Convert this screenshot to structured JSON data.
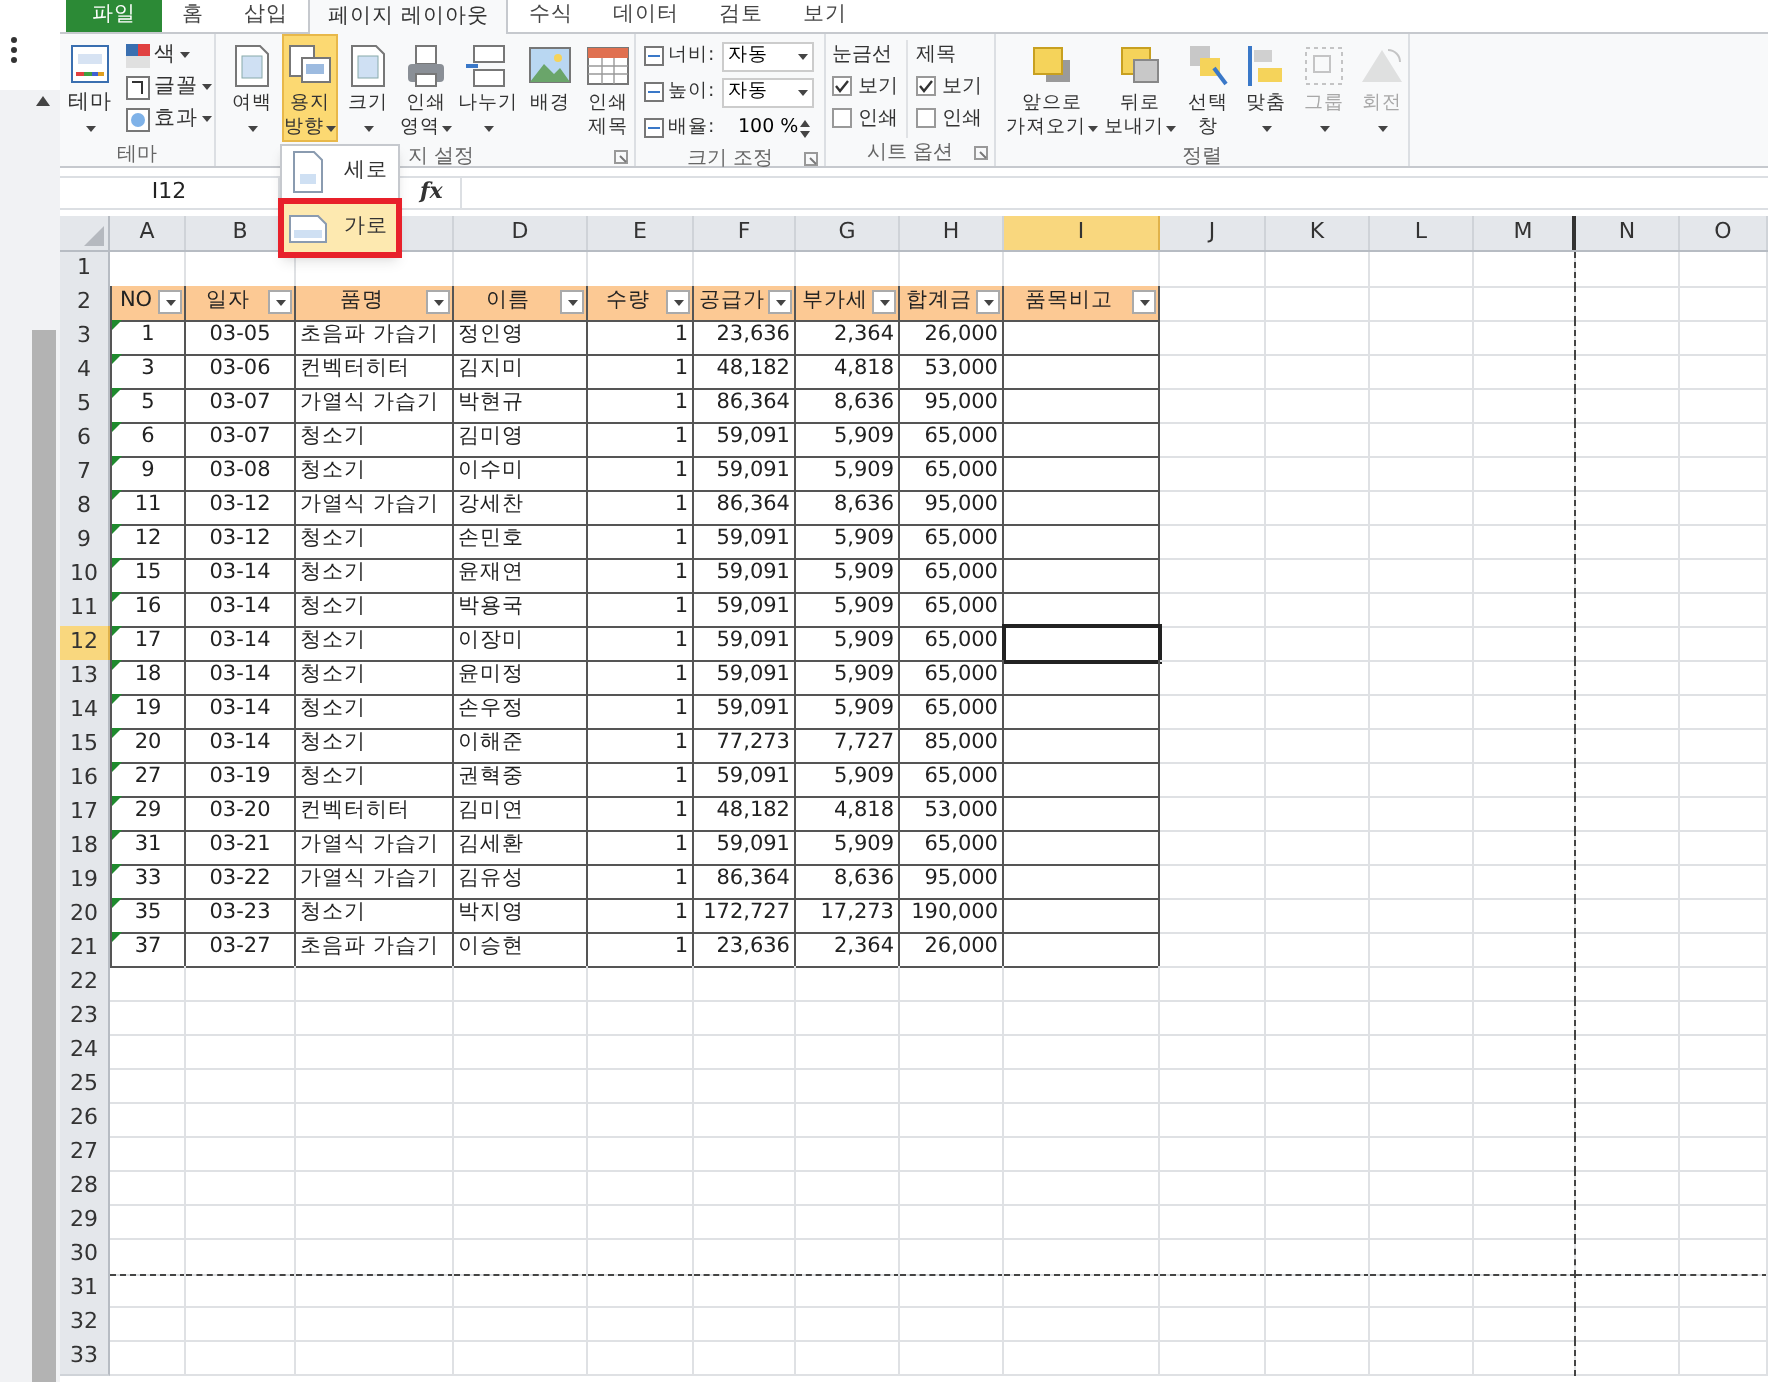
{
  "ribbon": {
    "tabs": [
      {
        "label": "파일",
        "kind": "file",
        "selected": false
      },
      {
        "label": "홈",
        "kind": "tab",
        "selected": false
      },
      {
        "label": "삽입",
        "kind": "tab",
        "selected": false
      },
      {
        "label": "페이지 레이아웃",
        "kind": "tab",
        "selected": true
      },
      {
        "label": "수식",
        "kind": "tab",
        "selected": false
      },
      {
        "label": "데이터",
        "kind": "tab",
        "selected": false
      },
      {
        "label": "검토",
        "kind": "tab",
        "selected": false
      },
      {
        "label": "보기",
        "kind": "tab",
        "selected": false
      }
    ],
    "theme_group": {
      "label": "테마",
      "big_button": {
        "label": "테마"
      },
      "items": [
        {
          "label": "색"
        },
        {
          "label": "글꼴"
        },
        {
          "label": "효과"
        }
      ]
    },
    "page_setup_group": {
      "label": "지 설정",
      "buttons": [
        {
          "lines": [
            "여백"
          ],
          "dropdown": true,
          "active": false
        },
        {
          "lines": [
            "용지",
            "방향"
          ],
          "dropdown": true,
          "active": true
        },
        {
          "lines": [
            "크기"
          ],
          "dropdown": true,
          "active": false
        },
        {
          "lines": [
            "인쇄",
            "영역"
          ],
          "dropdown": true,
          "active": false
        },
        {
          "lines": [
            "나누기"
          ],
          "dropdown": true,
          "active": false
        },
        {
          "lines": [
            "배경"
          ],
          "dropdown": false,
          "active": false
        },
        {
          "lines": [
            "인쇄",
            "제목"
          ],
          "dropdown": false,
          "active": false
        }
      ]
    },
    "scale_group": {
      "label": "크기 조정",
      "fields": [
        {
          "label": "너비:",
          "value": "자동",
          "kind": "dropdown"
        },
        {
          "label": "높이:",
          "value": "자동",
          "kind": "dropdown"
        },
        {
          "label": "배율:",
          "value": "100 %",
          "kind": "spinner"
        }
      ]
    },
    "sheet_options_group": {
      "label": "시트 옵션",
      "columns": [
        {
          "title": "눈금선",
          "options": [
            {
              "label": "보기",
              "checked": true
            },
            {
              "label": "인쇄",
              "checked": false
            }
          ]
        },
        {
          "title": "제목",
          "options": [
            {
              "label": "보기",
              "checked": true
            },
            {
              "label": "인쇄",
              "checked": false
            }
          ]
        }
      ]
    },
    "arrange_group": {
      "label": "정렬",
      "buttons": [
        {
          "lines": [
            "앞으로",
            "가져오기"
          ],
          "dropdown": true,
          "disabled": false
        },
        {
          "lines": [
            "뒤로",
            "보내기"
          ],
          "dropdown": true,
          "disabled": false
        },
        {
          "lines": [
            "선택",
            "창"
          ],
          "dropdown": false,
          "disabled": false
        },
        {
          "lines": [
            "맞춤"
          ],
          "dropdown": true,
          "disabled": false
        },
        {
          "lines": [
            "그룹"
          ],
          "dropdown": true,
          "disabled": true
        },
        {
          "lines": [
            "회전"
          ],
          "dropdown": true,
          "disabled": true
        }
      ]
    }
  },
  "orientation_menu": {
    "items": [
      {
        "label": "세로",
        "selected": false
      },
      {
        "label": "가로",
        "selected": true
      }
    ]
  },
  "formula_bar": {
    "name_box": "I12",
    "fx": "fx"
  },
  "sheet": {
    "columns": [
      {
        "label": "A",
        "selected": false,
        "page_break": false
      },
      {
        "label": "B",
        "selected": false,
        "page_break": false
      },
      {
        "selected": false,
        "page_break": false
      },
      {
        "label": "D",
        "selected": false,
        "page_break": false
      },
      {
        "label": "E",
        "selected": false,
        "page_break": false
      },
      {
        "label": "F",
        "selected": false,
        "page_break": false
      },
      {
        "label": "G",
        "selected": false,
        "page_break": false
      },
      {
        "label": "H",
        "selected": false,
        "page_break": false
      },
      {
        "label": "I",
        "selected": true,
        "page_break": false
      },
      {
        "label": "J",
        "selected": false,
        "page_break": false
      },
      {
        "label": "K",
        "selected": false,
        "page_break": false
      },
      {
        "label": "L",
        "selected": false,
        "page_break": false
      },
      {
        "label": "M",
        "selected": false,
        "page_break": true
      },
      {
        "label": "N",
        "selected": false,
        "page_break": false
      },
      {
        "label": "O",
        "selected": false,
        "page_break": false
      }
    ],
    "rows": [
      {
        "header": "1",
        "kind": "empty",
        "selected": false,
        "page_break": false
      },
      {
        "header": "2",
        "kind": "table_header",
        "selected": false,
        "page_break": false,
        "cells": [
          "NO",
          "일자",
          "품명",
          "이름",
          "수량",
          "공급가",
          "부가세",
          "합계금",
          "품목비고"
        ]
      },
      {
        "header": "3",
        "kind": "data",
        "selected": false,
        "page_break": false,
        "error_mark": true,
        "cells": [
          "1",
          "03-05",
          "초음파 가습기",
          "정인영",
          "1",
          "23,636",
          "2,364",
          "26,000"
        ]
      },
      {
        "header": "4",
        "kind": "data",
        "selected": false,
        "page_break": false,
        "error_mark": true,
        "cells": [
          "3",
          "03-06",
          "컨벡터히터",
          "김지미",
          "1",
          "48,182",
          "4,818",
          "53,000"
        ]
      },
      {
        "header": "5",
        "kind": "data",
        "selected": false,
        "page_break": false,
        "error_mark": true,
        "cells": [
          "5",
          "03-07",
          "가열식 가습기",
          "박현규",
          "1",
          "86,364",
          "8,636",
          "95,000"
        ]
      },
      {
        "header": "6",
        "kind": "data",
        "selected": false,
        "page_break": false,
        "error_mark": true,
        "cells": [
          "6",
          "03-07",
          "청소기",
          "김미영",
          "1",
          "59,091",
          "5,909",
          "65,000"
        ]
      },
      {
        "header": "7",
        "kind": "data",
        "selected": false,
        "page_break": false,
        "error_mark": true,
        "cells": [
          "9",
          "03-08",
          "청소기",
          "이수미",
          "1",
          "59,091",
          "5,909",
          "65,000"
        ]
      },
      {
        "header": "8",
        "kind": "data",
        "selected": false,
        "page_break": false,
        "error_mark": true,
        "cells": [
          "11",
          "03-12",
          "가열식 가습기",
          "강세찬",
          "1",
          "86,364",
          "8,636",
          "95,000"
        ]
      },
      {
        "header": "9",
        "kind": "data",
        "selected": false,
        "page_break": false,
        "error_mark": true,
        "cells": [
          "12",
          "03-12",
          "청소기",
          "손민호",
          "1",
          "59,091",
          "5,909",
          "65,000"
        ]
      },
      {
        "header": "10",
        "kind": "data",
        "selected": false,
        "page_break": false,
        "error_mark": true,
        "cells": [
          "15",
          "03-14",
          "청소기",
          "윤재연",
          "1",
          "59,091",
          "5,909",
          "65,000"
        ]
      },
      {
        "header": "11",
        "kind": "data",
        "selected": false,
        "page_break": false,
        "error_mark": true,
        "cells": [
          "16",
          "03-14",
          "청소기",
          "박용국",
          "1",
          "59,091",
          "5,909",
          "65,000"
        ]
      },
      {
        "header": "12",
        "kind": "data",
        "selected": true,
        "page_break": false,
        "error_mark": true,
        "cells": [
          "17",
          "03-14",
          "청소기",
          "이장미",
          "1",
          "59,091",
          "5,909",
          "65,000"
        ]
      },
      {
        "header": "13",
        "kind": "data",
        "selected": false,
        "page_break": false,
        "error_mark": true,
        "cells": [
          "18",
          "03-14",
          "청소기",
          "윤미정",
          "1",
          "59,091",
          "5,909",
          "65,000"
        ]
      },
      {
        "header": "14",
        "kind": "data",
        "selected": false,
        "page_break": false,
        "error_mark": true,
        "cells": [
          "19",
          "03-14",
          "청소기",
          "손우정",
          "1",
          "59,091",
          "5,909",
          "65,000"
        ]
      },
      {
        "header": "15",
        "kind": "data",
        "selected": false,
        "page_break": false,
        "error_mark": true,
        "cells": [
          "20",
          "03-14",
          "청소기",
          "이해준",
          "1",
          "77,273",
          "7,727",
          "85,000"
        ]
      },
      {
        "header": "16",
        "kind": "data",
        "selected": false,
        "page_break": false,
        "error_mark": true,
        "cells": [
          "27",
          "03-19",
          "청소기",
          "권혁중",
          "1",
          "59,091",
          "5,909",
          "65,000"
        ]
      },
      {
        "header": "17",
        "kind": "data",
        "selected": false,
        "page_break": false,
        "error_mark": true,
        "cells": [
          "29",
          "03-20",
          "컨벡터히터",
          "김미연",
          "1",
          "48,182",
          "4,818",
          "53,000"
        ]
      },
      {
        "header": "18",
        "kind": "data",
        "selected": false,
        "page_break": false,
        "error_mark": true,
        "cells": [
          "31",
          "03-21",
          "가열식 가습기",
          "김세환",
          "1",
          "59,091",
          "5,909",
          "65,000"
        ]
      },
      {
        "header": "19",
        "kind": "data",
        "selected": false,
        "page_break": false,
        "error_mark": true,
        "cells": [
          "33",
          "03-22",
          "가열식 가습기",
          "김유성",
          "1",
          "86,364",
          "8,636",
          "95,000"
        ]
      },
      {
        "header": "20",
        "kind": "data",
        "selected": false,
        "page_break": false,
        "error_mark": true,
        "cells": [
          "35",
          "03-23",
          "청소기",
          "박지영",
          "1",
          "172,727",
          "17,273",
          "190,000"
        ]
      },
      {
        "header": "21",
        "kind": "data",
        "selected": false,
        "page_break": false,
        "error_mark": true,
        "cells": [
          "37",
          "03-27",
          "초음파 가습기",
          "이승현",
          "1",
          "23,636",
          "2,364",
          "26,000"
        ]
      },
      {
        "header": "22",
        "kind": "empty",
        "selected": false,
        "page_break": false
      },
      {
        "header": "23",
        "kind": "empty",
        "selected": false,
        "page_break": false
      },
      {
        "header": "24",
        "kind": "empty",
        "selected": false,
        "page_break": false
      },
      {
        "header": "25",
        "kind": "empty",
        "selected": false,
        "page_break": false
      },
      {
        "header": "26",
        "kind": "empty",
        "selected": false,
        "page_break": false
      },
      {
        "header": "27",
        "kind": "empty",
        "selected": false,
        "page_break": false
      },
      {
        "header": "28",
        "kind": "empty",
        "selected": false,
        "page_break": false
      },
      {
        "header": "29",
        "kind": "empty",
        "selected": false,
        "page_break": false
      },
      {
        "header": "30",
        "kind": "empty",
        "selected": false,
        "page_break": true
      },
      {
        "header": "31",
        "kind": "empty",
        "selected": false,
        "page_break": false
      },
      {
        "header": "32",
        "kind": "empty",
        "selected": false,
        "page_break": false
      },
      {
        "header": "33",
        "kind": "empty",
        "selected": false,
        "page_break": false
      }
    ]
  }
}
